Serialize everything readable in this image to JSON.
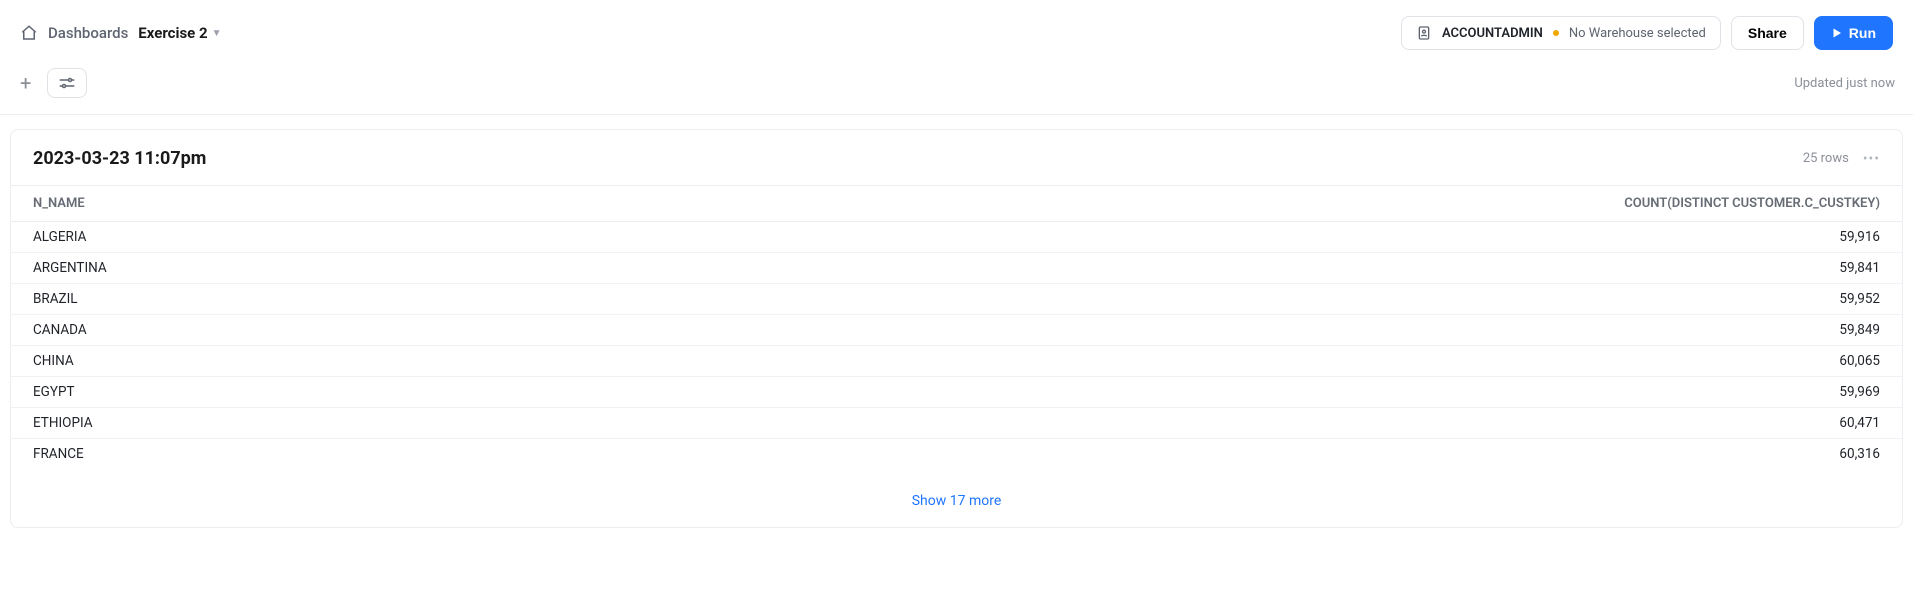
{
  "header": {
    "breadcrumb_root": "Dashboards",
    "dashboard_name": "Exercise 2",
    "account_role": "ACCOUNTADMIN",
    "warehouse_status": "No Warehouse selected",
    "share_label": "Share",
    "run_label": "Run"
  },
  "toolbar": {
    "updated_text": "Updated just now"
  },
  "panel": {
    "title": "2023-03-23 11:07pm",
    "rows_label": "25 rows",
    "columns": [
      "N_NAME",
      "COUNT(DISTINCT CUSTOMER.C_CUSTKEY)"
    ],
    "rows": [
      {
        "name": "ALGERIA",
        "count": "59,916"
      },
      {
        "name": "ARGENTINA",
        "count": "59,841"
      },
      {
        "name": "BRAZIL",
        "count": "59,952"
      },
      {
        "name": "CANADA",
        "count": "59,849"
      },
      {
        "name": "CHINA",
        "count": "60,065"
      },
      {
        "name": "EGYPT",
        "count": "59,969"
      },
      {
        "name": "ETHIOPIA",
        "count": "60,471"
      },
      {
        "name": "FRANCE",
        "count": "60,316"
      }
    ],
    "show_more_label": "Show 17 more"
  }
}
